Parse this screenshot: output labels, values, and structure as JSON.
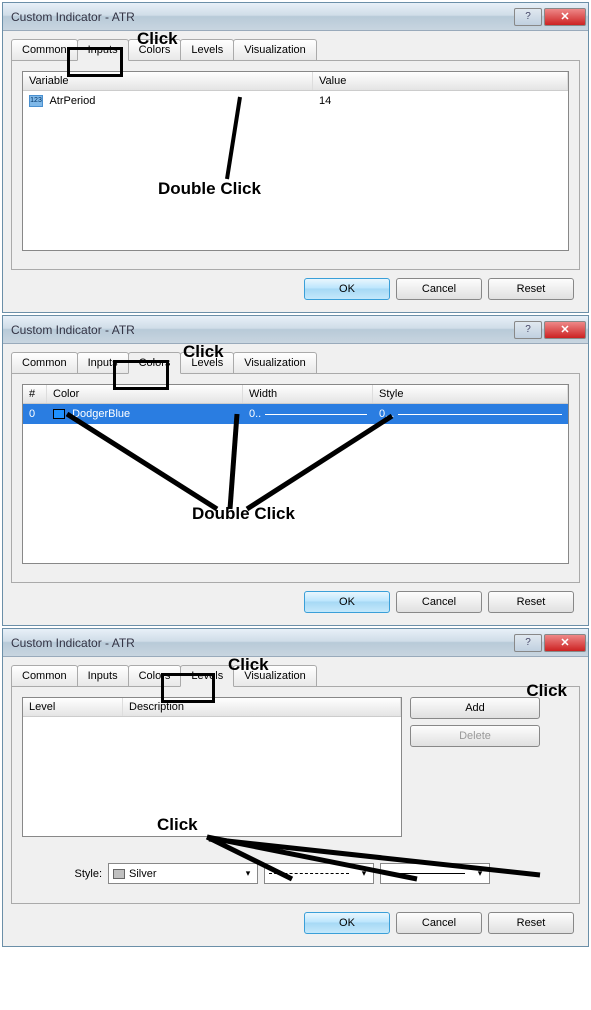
{
  "dialogs": {
    "title": "Custom Indicator - ATR",
    "tabs": {
      "common": "Common",
      "inputs": "Inputs",
      "colors": "Colors",
      "levels": "Levels",
      "visualization": "Visualization"
    },
    "buttons": {
      "ok": "OK",
      "cancel": "Cancel",
      "reset": "Reset",
      "add": "Add",
      "delete": "Delete"
    }
  },
  "panel1": {
    "headers": {
      "variable": "Variable",
      "value": "Value"
    },
    "row": {
      "name": "AtrPeriod",
      "value": "14"
    }
  },
  "panel2": {
    "headers": {
      "num": "#",
      "color": "Color",
      "width": "Width",
      "style": "Style"
    },
    "row": {
      "num": "0",
      "color": "DodgerBlue",
      "width": "0..",
      "style": "0..."
    }
  },
  "panel3": {
    "headers": {
      "level": "Level",
      "description": "Description"
    },
    "style_label": "Style:",
    "style_color": "Silver"
  },
  "annotations": {
    "click": "Click",
    "dblclick": "Double Click"
  }
}
